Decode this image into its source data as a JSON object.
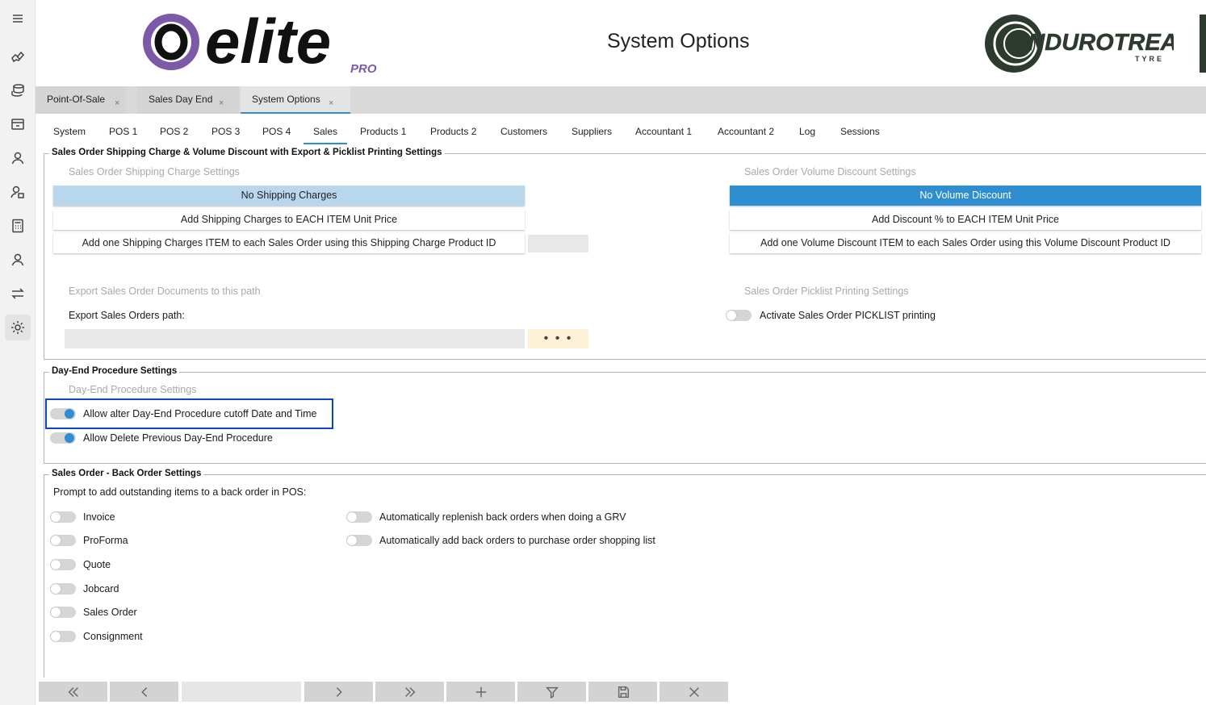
{
  "header": {
    "title": "System Options",
    "logo_left_text": "elite",
    "logo_left_sub": "PRO",
    "logo_right_text": "ENDUROTREAD",
    "logo_right_sub": "TYRE"
  },
  "rail": {
    "icons": [
      "menu-icon",
      "handshake-icon",
      "coins-icon",
      "register-icon",
      "user-icon",
      "user-settings-icon",
      "calculator-icon",
      "person-icon",
      "transfer-icon",
      "gear-icon"
    ]
  },
  "doc_tabs": [
    {
      "label": "Point-Of-Sale",
      "close": "×"
    },
    {
      "label": "Sales Day End",
      "close": "×"
    },
    {
      "label": "System Options",
      "close": "×"
    }
  ],
  "section_tabs": [
    "System",
    "POS 1",
    "POS 2",
    "POS 3",
    "POS 4",
    "Sales",
    "Products 1",
    "Products 2",
    "Customers",
    "Suppliers",
    "Accountant 1",
    "Accountant 2",
    "Log",
    "Sessions"
  ],
  "active_section_tab": "Sales",
  "shipping_group": {
    "title": "Sales Order Shipping Charge & Volume Discount with Export & Picklist Printing Settings",
    "shipping": {
      "label": "Sales Order Shipping Charge Settings",
      "options": [
        "No Shipping Charges",
        "Add Shipping Charges to EACH ITEM Unit Price",
        "Add one Shipping Charges ITEM to each Sales Order using this Shipping Charge Product ID"
      ],
      "selected": "No Shipping Charges"
    },
    "discount": {
      "label": "Sales Order Volume Discount Settings",
      "options": [
        "No Volume Discount",
        "Add Discount % to EACH ITEM Unit Price",
        "Add one Volume Discount ITEM to each Sales Order using this Volume Discount Product ID"
      ],
      "selected": "No Volume Discount"
    },
    "export": {
      "label": "Export Sales Order Documents to this path",
      "path_label": "Export Sales Orders path:",
      "browse": "• • •"
    },
    "picklist": {
      "label": "Sales Order Picklist Printing Settings",
      "toggle_label": "Activate Sales Order PICKLIST printing",
      "on": false
    }
  },
  "dayend_group": {
    "title": "Day-End Procedure Settings",
    "label": "Day-End Procedure Settings",
    "toggles": [
      {
        "label": "Allow alter Day-End Procedure cutoff Date and Time",
        "on": true
      },
      {
        "label": "Allow Delete Previous Day-End Procedure",
        "on": true
      }
    ]
  },
  "backorder_group": {
    "title": "Sales Order - Back Order Settings",
    "prompt": "Prompt to add outstanding items to a back order in POS:",
    "left_toggles": [
      {
        "label": "Invoice",
        "on": false
      },
      {
        "label": "ProForma",
        "on": false
      },
      {
        "label": "Quote",
        "on": false
      },
      {
        "label": "Jobcard",
        "on": false
      },
      {
        "label": "Sales Order",
        "on": false
      },
      {
        "label": "Consignment",
        "on": false
      }
    ],
    "right_toggles": [
      {
        "label": "Automatically replenish back orders when doing a GRV",
        "on": false
      },
      {
        "label": "Automatically add back orders to purchase order shopping list",
        "on": false
      }
    ]
  },
  "toolbar": {
    "buttons": [
      "first-icon",
      "previous-icon",
      "next-icon",
      "last-icon",
      "add-icon",
      "filter-icon",
      "save-icon",
      "close-icon"
    ]
  }
}
